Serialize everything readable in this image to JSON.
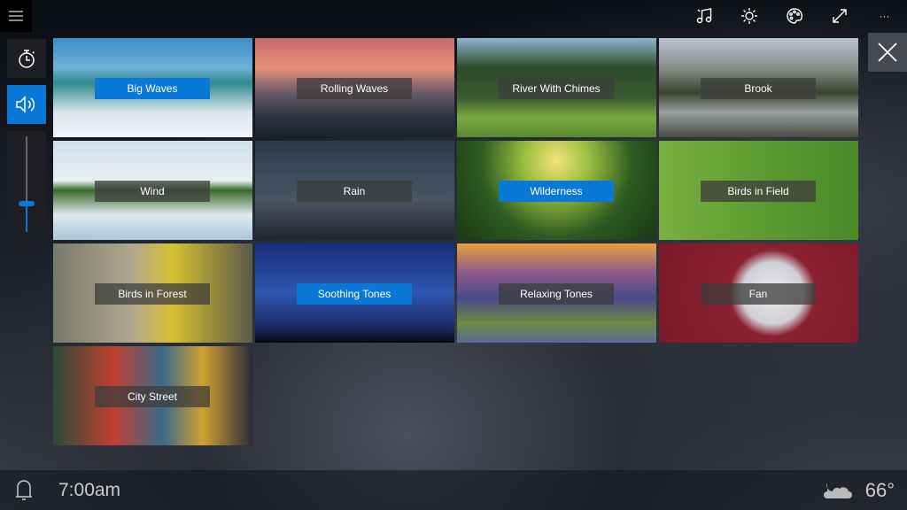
{
  "topbar": {
    "icons": [
      "music-icon",
      "brightness-icon",
      "palette-icon",
      "fullscreen-icon",
      "more-icon"
    ],
    "more_label": "···"
  },
  "side": {
    "volume_level": 0.3
  },
  "accent": "#0a78d7",
  "tiles": [
    {
      "label": "Big Waves",
      "selected": true,
      "bg": "linear-gradient(#3b8fc6 0%,#6fb0d8 30%,#2f8a8e 45%,#d9e6ee 75%,#f0f4f8)"
    },
    {
      "label": "Rolling Waves",
      "selected": false,
      "bg": "linear-gradient(#c56a6a 0%,#e88f7a 30%,#6a5a6a 55%,#2a3440 80%,#1b222a)"
    },
    {
      "label": "River With Chimes",
      "selected": false,
      "bg": "linear-gradient(#8fb6d0 0%,#2d4a2a 30%,#3c5a30 60%,#7aa840 80%,#5a8a30)"
    },
    {
      "label": "Brook",
      "selected": false,
      "bg": "linear-gradient(#b8c4d0 0%,#8a8e8a 30%,#3a4430 55%,#9aa0a0 75%,#4a4a44)"
    },
    {
      "label": "Wind",
      "selected": false,
      "bg": "linear-gradient(#cfe0ea 0%,#e8f0f4 40%,#3a6a2a 50%,#dfe9ee 75%,#a8c8d8)"
    },
    {
      "label": "Rain",
      "selected": false,
      "bg": "linear-gradient(#2a3a48 0%,#3e4e5e 40%,#4a5662 60%,#1e262e)"
    },
    {
      "label": "Wilderness",
      "selected": true,
      "bg": "radial-gradient(circle at 50% 20%,#f6e27a 0%,#9cc040 25%,#2c5a20 60%,#1a3a14)"
    },
    {
      "label": "Birds in Field",
      "selected": false,
      "bg": "linear-gradient(90deg,#7ab040 0%,#5a9a30 55%,#4a8a2a 100%)"
    },
    {
      "label": "Birds in Forest",
      "selected": false,
      "bg": "linear-gradient(90deg,#7a7a6a 0%,#b0a890 40%,#d6c030 60%,#5a5a4a)"
    },
    {
      "label": "Soothing Tones",
      "selected": true,
      "bg": "linear-gradient(#1a2e7a 0%,#2f56b0 50%,#1a2a60 85%,#050810)"
    },
    {
      "label": "Relaxing Tones",
      "selected": false,
      "bg": "linear-gradient(#e8a040 0%,#8a5a8a 30%,#4a4a8a 55%,#6a8a40 80%,#5a6a9a)"
    },
    {
      "label": "Fan",
      "selected": false,
      "bg": "radial-gradient(circle at 57% 50%,#e8e8ec 0%,#d0d0d6 25%,#8a2030 35%,#7a1a28)"
    },
    {
      "label": "City Street",
      "selected": false,
      "bg": "linear-gradient(90deg,#2a4a3a,#c04030 30%,#3a6a8a 55%,#d0a030 75%,#2a2a3a)"
    }
  ],
  "bottom": {
    "alarm_time": "7:00am",
    "temperature": "66°",
    "weather_icon": "partly-cloudy-icon"
  }
}
